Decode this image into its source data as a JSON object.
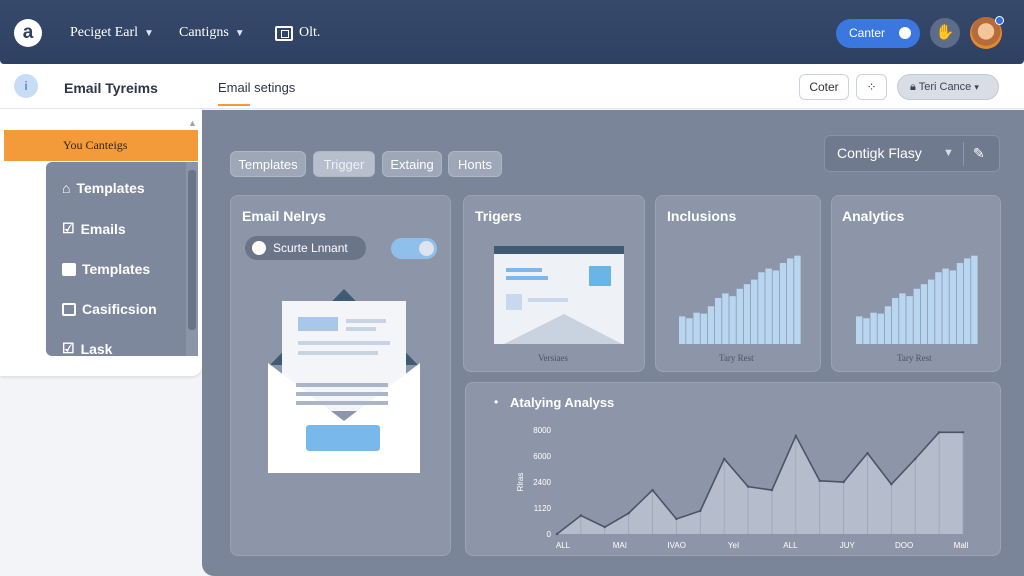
{
  "topbar": {
    "logo": "a",
    "nav": [
      {
        "label": "Peciget Earl"
      },
      {
        "label": "Cantigns"
      },
      {
        "label": "Olt."
      }
    ],
    "center_button": "Canter",
    "accent": "#3a78e0"
  },
  "sidebar": {
    "title": "Email Tyreims",
    "active_item": "You Canteigs",
    "items": [
      {
        "label": "Templates",
        "icon": "home-icon"
      },
      {
        "label": "Emails",
        "icon": "checkbox-icon"
      },
      {
        "label": "Templates",
        "icon": "folder-icon"
      },
      {
        "label": "Casificsion",
        "icon": "tag-icon"
      },
      {
        "label": "Lask",
        "icon": "checkbox-icon"
      }
    ]
  },
  "header": {
    "title": "Email setings",
    "buttons": {
      "color": "Coter",
      "cancel": "Teri Cance"
    }
  },
  "tabs": [
    {
      "label": "Templates"
    },
    {
      "label": "Trigger"
    },
    {
      "label": "Extaing"
    },
    {
      "label": "Honts"
    }
  ],
  "dropdown": {
    "value": "Contigk Flasy"
  },
  "panels": {
    "email": {
      "title": "Email Nelrys",
      "toggle_label": "Scurte Lnnant"
    },
    "triggers": {
      "title": "Trigers",
      "caption": "Versiaes"
    },
    "inclusions": {
      "title": "Inclusions",
      "caption": "Tary Rest"
    },
    "analytics": {
      "title": "Analytics",
      "caption": "Tary Rest"
    }
  },
  "chart_data": {
    "type": "area",
    "title": "Atalying Analyss",
    "ylabel": "Rlras",
    "yticks": [
      "0",
      "1120",
      "2400",
      "6000",
      "8000"
    ],
    "categories": [
      "ALL",
      "MAI",
      "IVAO",
      "YeI",
      "ALL",
      "JUY",
      "DOO",
      "Mall"
    ],
    "values": [
      0,
      1600,
      600,
      1800,
      3800,
      1300,
      2000,
      6500,
      4100,
      3800,
      8500,
      4600,
      4500,
      7000,
      4300,
      6500,
      8800,
      8800
    ],
    "ylim": [
      0,
      9000
    ],
    "fill": "#b9c1cf",
    "line": "#4a5468"
  },
  "mini_charts": {
    "inclusions": [
      0.3,
      0.28,
      0.34,
      0.33,
      0.41,
      0.5,
      0.55,
      0.52,
      0.6,
      0.65,
      0.7,
      0.78,
      0.82,
      0.8,
      0.88,
      0.93,
      0.96
    ],
    "analytics": [
      0.3,
      0.28,
      0.34,
      0.33,
      0.41,
      0.5,
      0.55,
      0.52,
      0.6,
      0.65,
      0.7,
      0.78,
      0.82,
      0.8,
      0.88,
      0.93,
      0.96
    ]
  }
}
